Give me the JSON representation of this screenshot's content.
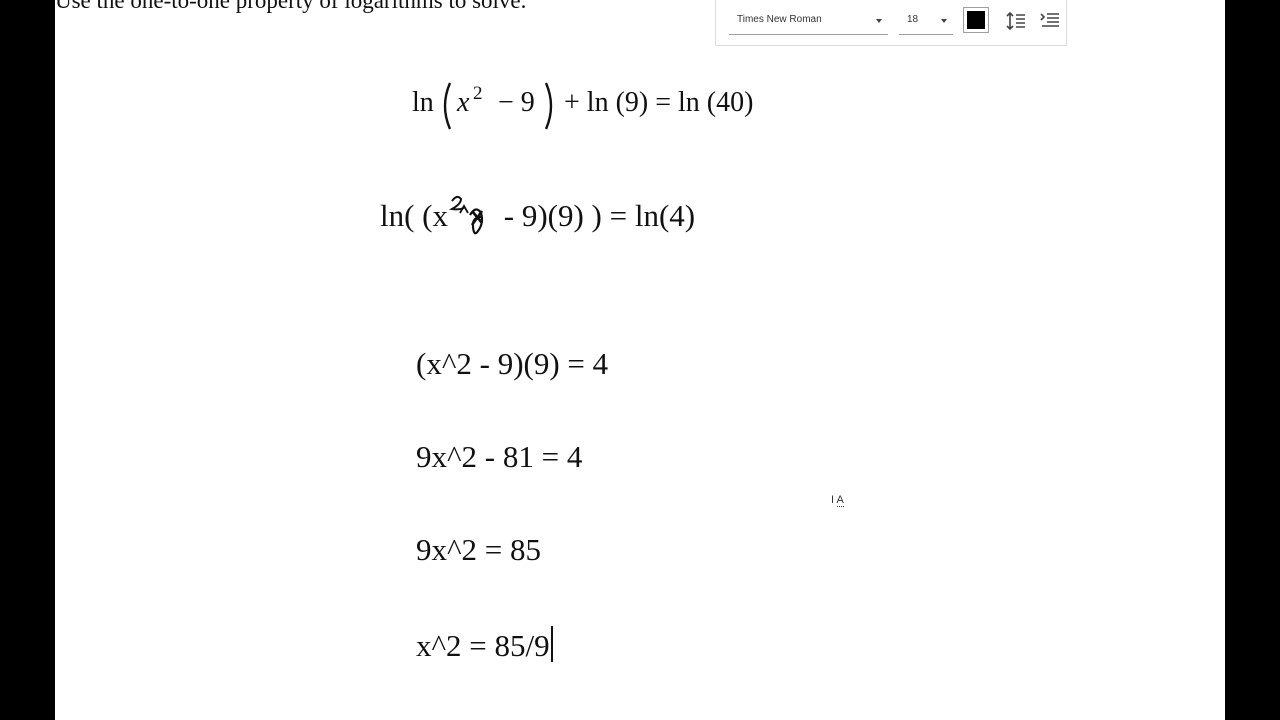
{
  "document": {
    "cutoff_heading": "Use the one-to-one property of logarithms to solve.",
    "equation_image": {
      "latex": "\\ln\\left(x^{2}-9\\right)+\\ln(9)=\\ln(40)",
      "part_ln1": "ln",
      "part_x": "x",
      "part_exp": "2",
      "part_minus9": "− 9",
      "part_rest": "+ ln (9) = ln (40)"
    },
    "lines": [
      "ln( (x^2 - 9)(9) ) = ln(4)",
      "(x^2 - 9)(9) = 4",
      "9x^2 - 81 = 4",
      "9x^2 = 85",
      "x^2 = 85/9"
    ],
    "line1_parts": {
      "before": "ln( (x",
      "after": " - 9)(9) ) = ln(4)"
    },
    "pointer_label": "A"
  },
  "toolbar": {
    "font_family": "Times New Roman",
    "font_size": "18",
    "text_color": "#000000",
    "icons": [
      "line-spacing-icon",
      "list-indent-icon"
    ]
  }
}
